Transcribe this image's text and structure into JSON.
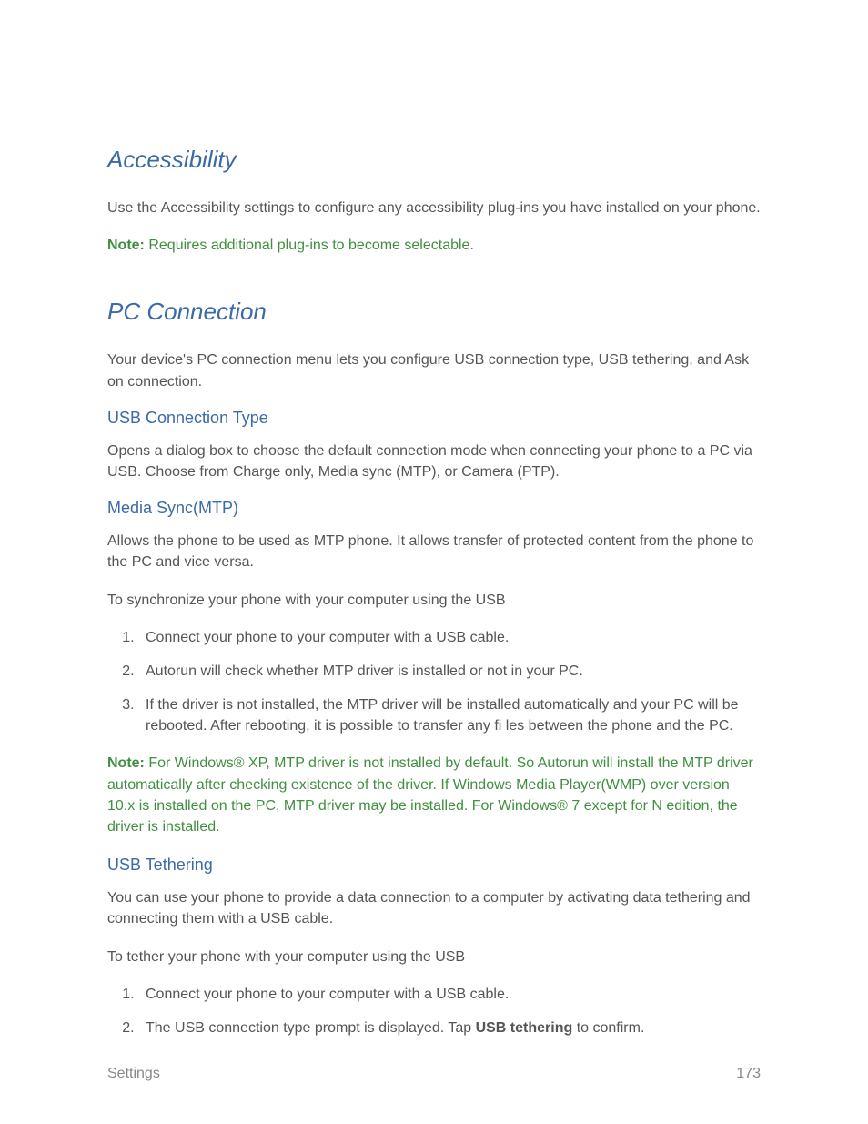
{
  "accessibility": {
    "heading": "Accessibility",
    "intro": "Use the Accessibility settings to configure any accessibility plug-ins you have installed on your phone.",
    "note_label": "Note:",
    "note_text": "  Requires additional plug-ins to become selectable."
  },
  "pc_connection": {
    "heading": "PC Connection",
    "intro": "Your device's PC connection menu lets you configure USB connection type, USB tethering, and Ask on connection.",
    "usb_type": {
      "heading": "USB Connection Type",
      "text": "Opens a dialog box to choose the default connection mode when connecting your phone to a PC via USB. Choose from Charge only, Media sync (MTP), or Camera (PTP)."
    },
    "media_sync": {
      "heading": "Media Sync(MTP)",
      "text1": "Allows the phone to be used as MTP phone. It allows transfer of protected content from the phone to the PC and vice versa.",
      "text2": "To synchronize your phone with your computer using the USB",
      "steps": [
        "Connect your phone to your computer with a USB cable.",
        "Autorun will check whether MTP driver is installed or not in your PC.",
        "If the driver is not installed, the MTP driver will be installed automatically and your PC will be rebooted. After rebooting, it is possible to transfer any fi les between the phone and the PC."
      ],
      "note_label": "Note:",
      "note_text": "  For Windows® XP, MTP driver is not installed by default. So Autorun will install the MTP driver automatically after checking existence of the driver. If Windows Media Player(WMP) over version 10.x is installed on the PC, MTP driver may be installed. For Windows® 7 except for N edition, the driver is installed."
    },
    "usb_tethering": {
      "heading": "USB Tethering",
      "text1": "You can use your phone to provide a data connection to a computer by activating data tethering and connecting them with a USB cable.",
      "text2": "To tether your phone with your computer using the USB",
      "step1": "Connect your phone to your computer with a USB cable.",
      "step2_prefix": "The USB connection type prompt is displayed. Tap ",
      "step2_bold": "USB tethering",
      "step2_suffix": " to confirm."
    }
  },
  "footer": {
    "left": "Settings",
    "right": "173"
  }
}
